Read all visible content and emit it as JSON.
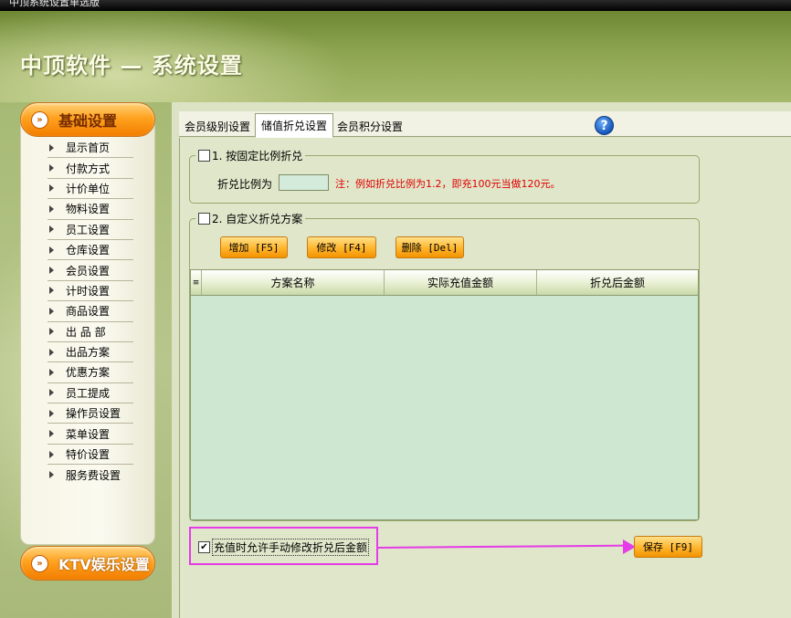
{
  "window": {
    "title": "中顶系统设置单选版"
  },
  "header": {
    "brand": "中顶软件 — 系统设置"
  },
  "nav": {
    "basic_label": "基础设置",
    "ktv_label": "KTV娱乐设置",
    "items": [
      "显示首页",
      "付款方式",
      "计价单位",
      "物料设置",
      "员工设置",
      "仓库设置",
      "会员设置",
      "计时设置",
      "商品设置",
      "出 品 部",
      "出品方案",
      "优惠方案",
      "员工提成",
      "操作员设置",
      "菜单设置",
      "特价设置",
      "服务费设置"
    ]
  },
  "tabs": [
    {
      "label": "会员级别设置",
      "active": false
    },
    {
      "label": "储值折兑设置",
      "active": true
    },
    {
      "label": "会员积分设置",
      "active": false
    }
  ],
  "help_icon": "?",
  "fixed_ratio": {
    "checkbox_label": "1. 按固定比例折兑",
    "checked": false,
    "ratio_label": "折兑比例为",
    "ratio_value": "",
    "note": "注：例如折兑比例为1.2，即充100元当做120元。"
  },
  "custom_plan": {
    "checkbox_label": "2. 自定义折兑方案",
    "checked": false,
    "buttons": {
      "add": "增加 [F5]",
      "edit": "修改 [F4]",
      "delete": "删除 [Del]"
    },
    "columns": [
      "方案名称",
      "实际充值金额",
      "折兑后金额"
    ],
    "rows": []
  },
  "manual_edit": {
    "label": "充值时允许手动修改折兑后金额",
    "checked": true
  },
  "save_button": "保存 [F9]",
  "colors": {
    "accent_orange": "#ffa21f",
    "highlight_magenta": "#e53be8",
    "note_red": "#e00000"
  }
}
